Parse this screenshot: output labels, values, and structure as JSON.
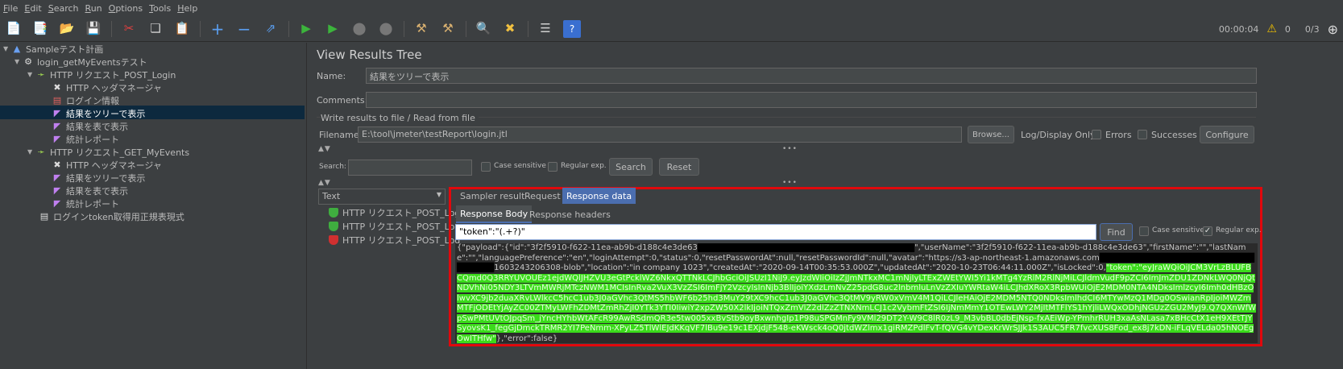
{
  "menu": [
    "File",
    "Edit",
    "Search",
    "Run",
    "Options",
    "Tools",
    "Help"
  ],
  "toolbar": {
    "icons": [
      "new-icon",
      "templates-icon",
      "open-icon",
      "save-icon",
      "cut-icon",
      "copy-icon",
      "paste-icon",
      "expand-icon",
      "collapse-icon",
      "toggle-icon",
      "start-icon",
      "start-no-pause-icon",
      "stop-icon",
      "shutdown-icon",
      "clear-icon",
      "clear-all-icon",
      "search-icon",
      "reset-search-icon",
      "function-helper-icon",
      "help-icon"
    ],
    "timer": "00:00:04",
    "warnings": "0",
    "threads": "0/3"
  },
  "tree": {
    "nodes": [
      {
        "label": "Sampleテスト計画",
        "icon": "test-plan-icon"
      },
      {
        "label": "login_getMyEventsテスト",
        "icon": "thread-group-icon"
      },
      {
        "label": "HTTP リクエスト_POST_Login",
        "icon": "sampler-icon"
      },
      {
        "label": "HTTP ヘッダマネージャ",
        "icon": "config-icon"
      },
      {
        "label": "ログイン情報",
        "icon": "config-icon"
      },
      {
        "label": "結果をツリーで表示",
        "icon": "listener-icon"
      },
      {
        "label": "結果を表で表示",
        "icon": "listener-icon"
      },
      {
        "label": "統計レポート",
        "icon": "listener-icon"
      },
      {
        "label": "HTTP リクエスト_GET_MyEvents",
        "icon": "sampler-icon"
      },
      {
        "label": "HTTP ヘッダマネージャ",
        "icon": "config-icon"
      },
      {
        "label": "結果をツリーで表示",
        "icon": "listener-icon"
      },
      {
        "label": "結果を表で表示",
        "icon": "listener-icon"
      },
      {
        "label": "統計レポート",
        "icon": "listener-icon"
      },
      {
        "label": "ログインtoken取得用正規表現式",
        "icon": "extractor-icon"
      }
    ],
    "selected_index": 5
  },
  "panel": {
    "title": "View Results Tree",
    "name_label": "Name:",
    "name_value": "結果をツリーで表示",
    "comments_label": "Comments:",
    "comments_value": "",
    "file_section": "Write results to file / Read from file",
    "filename_label": "Filename",
    "filename_value": "E:\\tool\\jmeter\\testReport\\login.jtl",
    "browse": "Browse...",
    "log_display": "Log/Display Only:",
    "errors": "Errors",
    "successes": "Successes",
    "configure": "Configure"
  },
  "search": {
    "label": "Search:",
    "value": "",
    "case_sensitive": "Case sensitive",
    "regular_exp": "Regular exp.",
    "search_button": "Search",
    "reset_button": "Reset"
  },
  "renderer": {
    "selected": "Text",
    "samples": [
      {
        "label": "HTTP リクエスト_POST_Log",
        "status": "success"
      },
      {
        "label": "HTTP リクエスト_POST_Log",
        "status": "success"
      },
      {
        "label": "HTTP リクエスト_POST_Log",
        "status": "error"
      }
    ]
  },
  "tabs": {
    "top": [
      "Sampler result",
      "Request",
      "Response data"
    ],
    "top_selected": "Response data",
    "sub": [
      "Response Body",
      "Response headers"
    ],
    "sub_selected": "Response Body"
  },
  "find": {
    "value": "\"token\":\"(.+?)\"",
    "button": "Find",
    "case_sensitive": "Case sensitive",
    "regular_exp": "Regular exp.",
    "regular_exp_checked": true
  },
  "response": {
    "part1": "{\"payload\":{\"id\":\"3f2f5910-f622-11ea-ab9b-d188c4e3de63",
    "part2": "\",\"userName\":\"3f2f5910-f622-11ea-ab9b-d188c4e3de63\",\"firstName\":\"\",\"lastName\":\"\",\"languagePreference\":\"en\",\"loginAttempt\":0,\"status\":0,\"resetPasswordAt\":null,\"resetPasswordId\":null,\"avatar\":\"https://s3-ap-northeast-1.amazonaws.com",
    "part3": "1603243206308-blob\",\"location\":\"in company 1023\",\"createdAt\":\"2020-09-14T00:35:53.000Z\",\"updatedAt\":\"2020-10-23T06:44:11.000Z\",\"isLocked\":0,",
    "token": "\"token\":\"eyJraWQiOiJCM3VrLzBLUFBCQmd0Q3RRYUVOUEz1ejdWQlJHZVU3eGtPcklWZ6NkxQTTNkLCJhbGciOiJSUzI1NiJ9.eyJzdWIiOiIzZjJmNTkxMC1mNjIyLTExZWEtYWI5Yi1kMTg4YzRlM2RlNjMiLCJldmVudF9pZCI6ImJmZDU1ZDNkLWQ0NjQtNDVhNi05NDY3LTVmMWRjMTczNWM1MCIsInRva2VuX3VzZSI6ImFjY2VzcyIsInNjb3BlIjoiYXdzLmNvZ25pdG8uc2lnbmluLnVzZXIuYWRtaW4iLCJhdXRoX3RpbWUiOjE2MDM0NTA4NDksImlzcyI6Imh0dHBzOlwvXC9jb2duaXRvLWlkcC5hcC1ub3J0aGVhc3QtMS5hbWF6b25hd3MuY29tXC9hcC1ub3J0aGVhc3QtMV9yRW0xVmV4M1QiLCJleHAiOjE2MDM5NTQ0NDksImlhdCI6MTYwMzQ1MDg0OSwianRpIjoiMWZmMTFjODEtYjAyZC00ZTMyLWFhZDMtZmRhZjI0YTk3YTI0IiwiY2xpZW50X2lkIjoiNTQxZmVlZ2dlZzZTNXNmLCJ1c2VybmFtZSI6IjNmMmY1OTEwLWY2MjItMTFlYS1hYjliLWQxODhjNGUzZGU2MyJ9.Q7QXnWfWpSwPMtUVtOJpqSm_jYncHYhbWtAFcR99AwRSdmQR3e5tw005xxBvStb9oyBxwnhgIp1P98uSPGMnFy9VMl29DT2Y-W9C8lR0zL9_M3vbBL0dbEjNsp-fxAEiWp-YPmhrRUH3xaAsNLasa7xBHcCtX1eH9XEtTJYSyovsK1_fegGjDmckTRMR2YI7PeNmm-XPyLZ5TlWlEJdKKqVF7lBu9e19c1EXjdjF548-eKWsck4oQ0jtdWZlmx1giRMZPdlFvT-fQVG4vYDexKrWrSJJk1S3AUC5FR7fvcXUS8Fod_ex8j7kDN-iFLqVELda05hNOEgOwITHfw\"",
    "part4": "},\"error\":false}"
  }
}
